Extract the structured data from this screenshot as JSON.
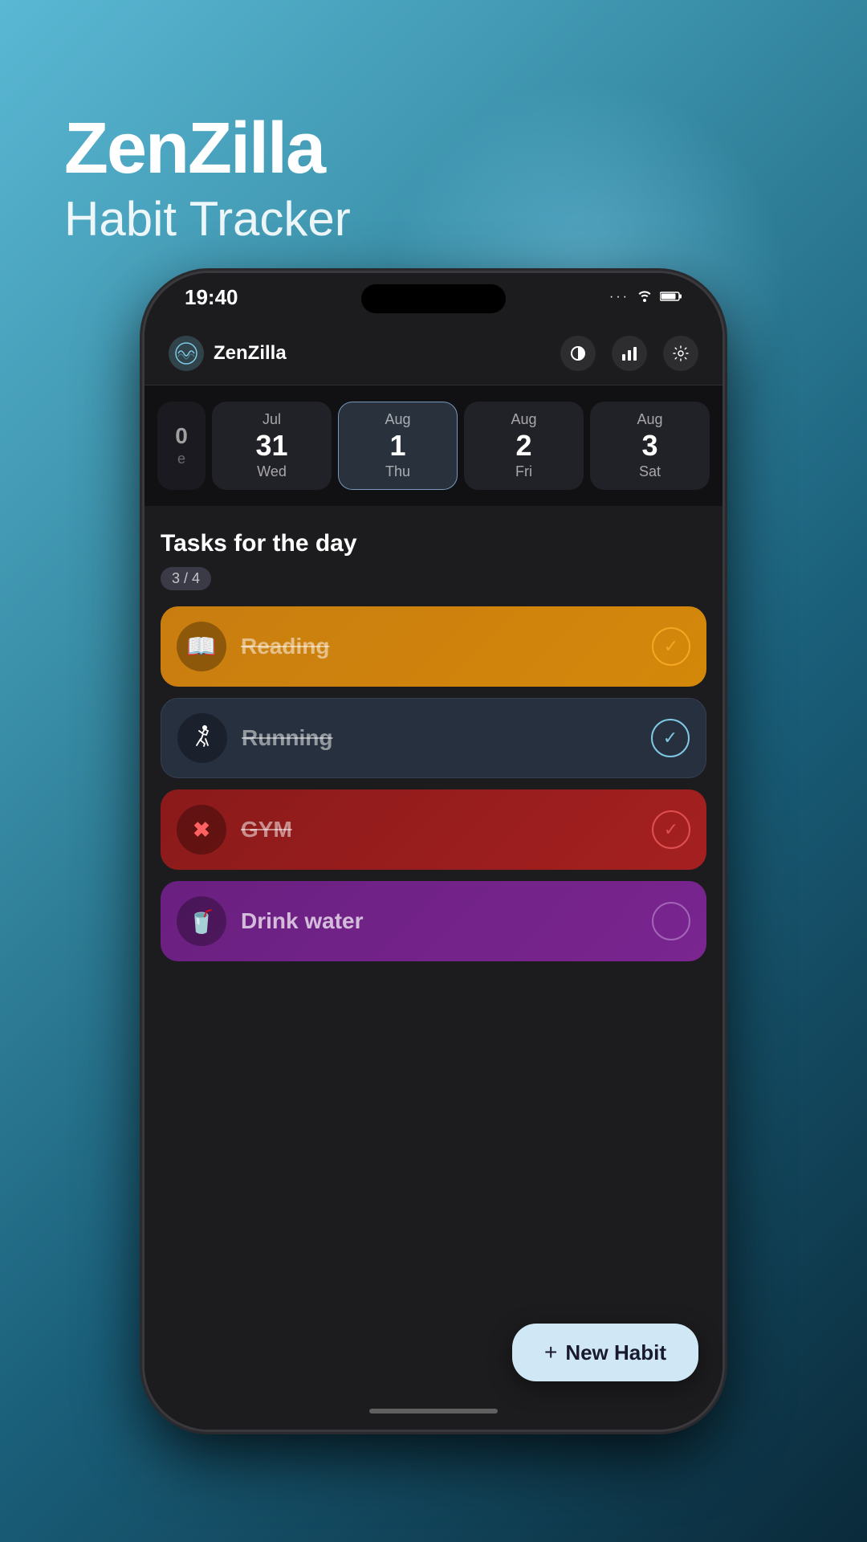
{
  "appTitle": {
    "name": "ZenZilla",
    "subtitle": "Habit Tracker"
  },
  "statusBar": {
    "time": "19:40",
    "wifi": "⊕",
    "battery": "▮"
  },
  "header": {
    "logoEmoji": "🌊",
    "logoText": "ZenZilla",
    "moonIcon": "◑",
    "chartIcon": "▦",
    "gearIcon": "⚙"
  },
  "calendar": {
    "days": [
      {
        "month": "Jul",
        "date": "31",
        "weekday": "Wed",
        "selected": false,
        "partial": false
      },
      {
        "month": "Aug",
        "date": "1",
        "weekday": "Thu",
        "selected": true,
        "partial": false
      },
      {
        "month": "Aug",
        "date": "2",
        "weekday": "Fri",
        "selected": false,
        "partial": false
      },
      {
        "month": "Aug",
        "date": "3",
        "weekday": "Sat",
        "selected": false,
        "partial": false
      }
    ]
  },
  "tasks": {
    "header": "Tasks for the day",
    "countBadge": "3 / 4",
    "habits": [
      {
        "id": "reading",
        "name": "Reading",
        "icon": "📖",
        "completed": true,
        "checkStyle": "checked-orange",
        "cardStyle": "reading"
      },
      {
        "id": "running",
        "name": "Running",
        "icon": "🏃",
        "completed": true,
        "checkStyle": "checked-blue",
        "cardStyle": "running"
      },
      {
        "id": "gym",
        "name": "GYM",
        "icon": "✖",
        "completed": true,
        "checkStyle": "checked-red",
        "cardStyle": "gym"
      },
      {
        "id": "drink-water",
        "name": "Drink water",
        "icon": "🥤",
        "completed": false,
        "checkStyle": "unchecked",
        "cardStyle": "drink-water"
      }
    ]
  },
  "newHabitButton": {
    "plus": "+",
    "label": "New Habit"
  }
}
